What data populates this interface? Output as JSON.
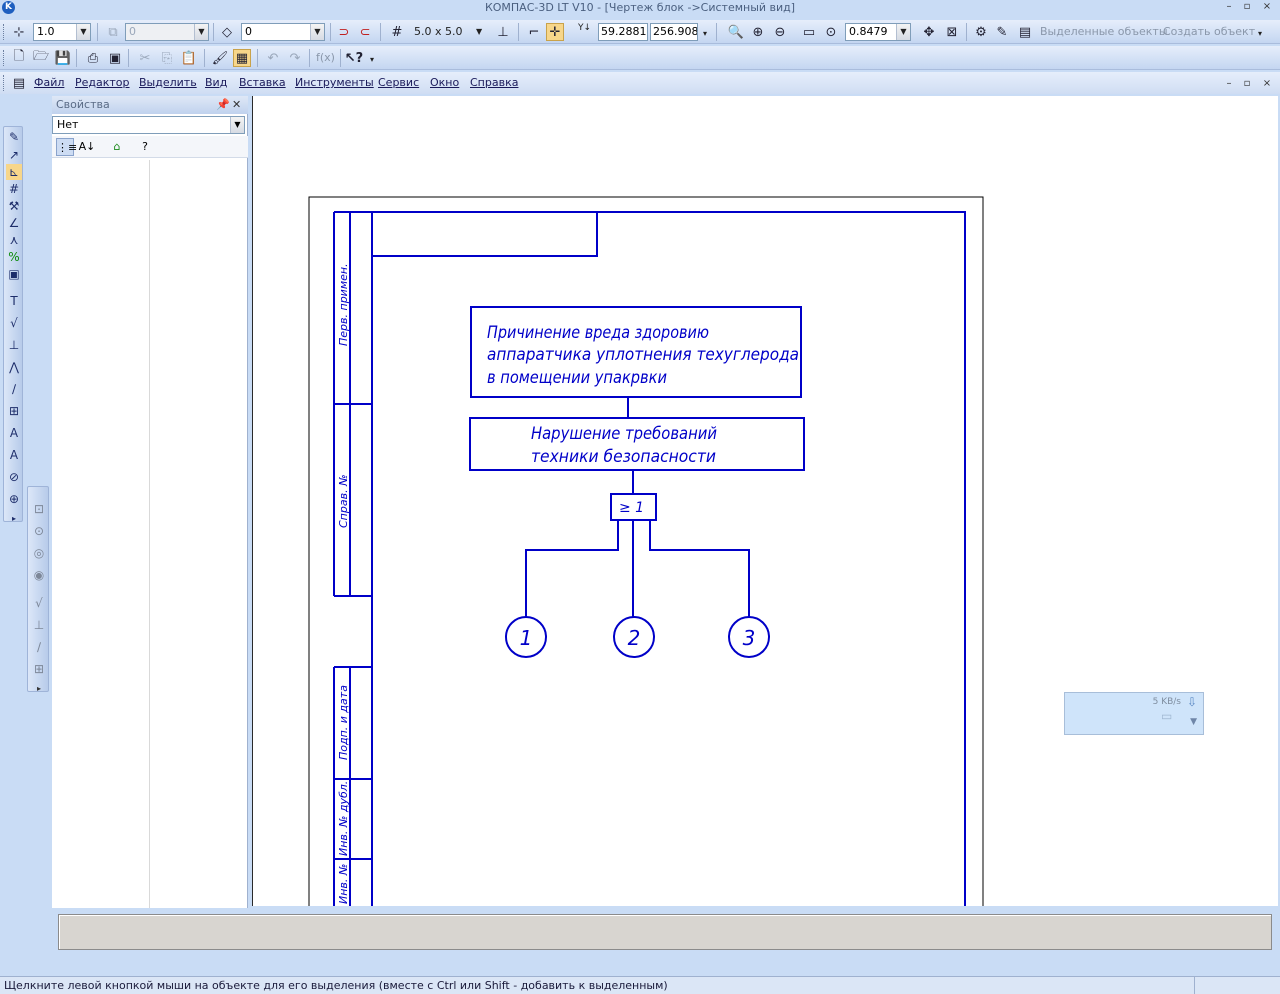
{
  "window": {
    "title": "КОМПАС-3D LT V10 - [Чертеж блок ->Системный вид]",
    "app_icon": "K",
    "controls": [
      "–",
      "▫",
      "×"
    ]
  },
  "toolbar1": {
    "scale_value": "1.0",
    "layer_value": "0",
    "style_value": "0",
    "grid_label": "5.0 x 5.0",
    "coord_x": "59.2881",
    "coord_y": "256.908",
    "zoom_value": "0.8479",
    "selected_objects": "Выделенные объекты",
    "create_object": "Создать объект",
    "grid_icon": "grid-icon",
    "coords_prefix": "Y↓"
  },
  "toolbar2": {
    "fx_label": "f(x)"
  },
  "menu": {
    "items": [
      "Файл",
      "Редактор",
      "Выделить",
      "Вид",
      "Вставка",
      "Инструменты",
      "Сервис",
      "Окно",
      "Справка"
    ]
  },
  "properties": {
    "title": "Свойства",
    "selector_value": "Нет"
  },
  "drawing": {
    "box1_lines": [
      "Причинение вреда здоровию",
      "аппаратчика уплотнения техуглерода",
      "в помещении упакрвки"
    ],
    "box2_lines": [
      "Нарушение требований",
      "техники безопасности"
    ],
    "gate_label": "≥ 1",
    "events": [
      "1",
      "2",
      "3"
    ],
    "stamp_labels": [
      "Перв. примен.",
      "Справ. №",
      "Подп. и дата",
      "Инв. № дубл.",
      "Инв. №"
    ]
  },
  "network": {
    "speed": "5 KB/s"
  },
  "status": {
    "hint": "Щелкните левой кнопкой мыши на объекте для его выделения (вместе с Ctrl или Shift - добавить к выделенным)"
  },
  "colors": {
    "drawing_line": "#0000c8",
    "chrome": "#c9dcf5"
  }
}
